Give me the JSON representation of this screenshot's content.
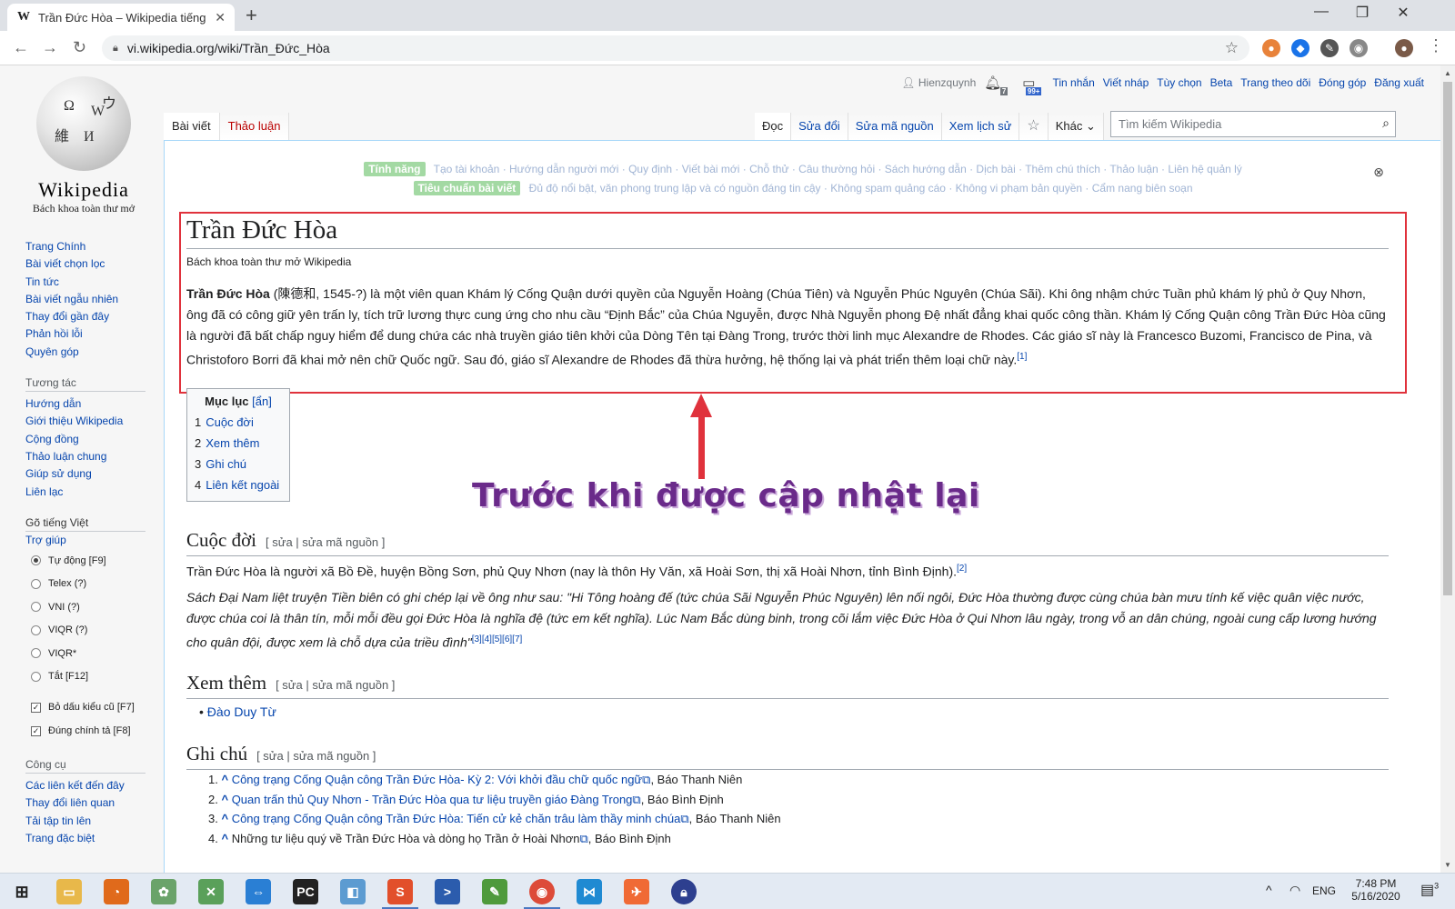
{
  "browser": {
    "tab_title": "Trần Đức Hòa – Wikipedia tiếng V",
    "favicon": "W",
    "url": "vi.wikipedia.org/wiki/Trần_Đức_Hòa"
  },
  "wiki": {
    "wordmark": "Wikipedia",
    "tagline": "Bách khoa toàn thư mở",
    "personal": {
      "user": "Hienzquynh",
      "alerts_count": "7",
      "notices_count": "99+",
      "links": [
        "Tin nhắn",
        "Viết nháp",
        "Tùy chọn",
        "Beta",
        "Trang theo dõi",
        "Đóng góp",
        "Đăng xuất"
      ]
    },
    "left_tabs": [
      "Bài viết",
      "Thảo luận"
    ],
    "right_tabs": [
      "Đọc",
      "Sửa đổi",
      "Sửa mã nguồn",
      "Xem lịch sử"
    ],
    "more_label": "Khác",
    "search_placeholder": "Tìm kiếm Wikipedia",
    "sidebar_main": [
      "Trang Chính",
      "Bài viết chọn lọc",
      "Tin tức",
      "Bài viết ngẫu nhiên",
      "Thay đổi gần đây",
      "Phản hồi lỗi",
      "Quyên góp"
    ],
    "sidebar_interact_heading": "Tương tác",
    "sidebar_interact": [
      "Hướng dẫn",
      "Giới thiệu Wikipedia",
      "Cộng đồng",
      "Thảo luận chung",
      "Giúp sử dụng",
      "Liên lạc"
    ],
    "sidebar_input_heading": "Gõ tiếng Việt",
    "sidebar_input_help": "Trợ giúp",
    "input_modes": [
      {
        "label": "Tự động [F9]",
        "selected": true
      },
      {
        "label": "Telex (?)",
        "selected": false
      },
      {
        "label": "VNI (?)",
        "selected": false
      },
      {
        "label": "VIQR (?)",
        "selected": false
      },
      {
        "label": "VIQR*",
        "selected": false
      },
      {
        "label": "Tắt [F12]",
        "selected": false
      }
    ],
    "input_options": [
      {
        "label": "Bỏ dấu kiểu cũ [F7]",
        "checked": true
      },
      {
        "label": "Đúng chính tả [F8]",
        "checked": true
      }
    ],
    "sidebar_tools_heading": "Công cụ",
    "sidebar_tools": [
      "Các liên kết đến đây",
      "Thay đổi liên quan",
      "Tải tập tin lên",
      "Trang đặc biệt"
    ],
    "notice_line1_label": "Tính năng",
    "notice_line1": "Tạo tài khoản · Hướng dẫn người mới · Quy định · Viết bài mới · Chỗ thử · Câu thường hỏi · Sách hướng dẫn · Dịch bài · Thêm chú thích · Thảo luận · Liên hệ quản lý",
    "notice_line2_label": "Tiêu chuẩn bài viết",
    "notice_line2": "Đủ độ nổi bật, văn phong trung lập và có nguồn đáng tin cậy · Không spam quảng cáo · Không vi phạm bản quyền · Cẩm nang biên soạn"
  },
  "article": {
    "title": "Trần Đức Hòa",
    "from": "Bách khoa toàn thư mở Wikipedia",
    "lead_bold": "Trần Đức Hòa",
    "lead_rest": "(陳德和, 1545-?) là một viên quan Khám lý Cống Quận dưới quyền của Nguyễn Hoàng (Chúa Tiên) và Nguyễn Phúc Nguyên (Chúa Sãi). Khi ông nhậm chức Tuần phủ khám lý phủ ở Quy Nhơn, ông đã có công giữ yên trấn ly, tích trữ lương thực cung ứng cho nhu cầu “Định Bắc” của Chúa Nguyễn, được Nhà Nguyễn phong Đệ nhất đẳng khai quốc công thần. Khám lý Cống Quận công Trần Đức Hòa cũng là người đã bất chấp nguy hiểm để dung chứa các nhà truyền giáo tiên khởi của Dòng Tên tại Đàng Trong, trước thời linh mục Alexandre de Rhodes. Các giáo sĩ này là Francesco Buzomi, Francisco de Pina, và Christoforo Borri đã khai mở nên chữ Quốc ngữ. Sau đó, giáo sĩ Alexandre de Rhodes đã thừa hưởng, hệ thống lại và phát triển thêm loại chữ này.",
    "lead_ref": "[1]",
    "toc_title": "Mục lục",
    "toc_hide": "[ẩn]",
    "toc": [
      {
        "num": "1",
        "label": "Cuộc đời"
      },
      {
        "num": "2",
        "label": "Xem thêm"
      },
      {
        "num": "3",
        "label": "Ghi chú"
      },
      {
        "num": "4",
        "label": "Liên kết ngoài"
      }
    ],
    "callout": "Trước khi được cập nhật lại",
    "sec1_title": "Cuộc đời",
    "sec1_edit": "[ sửa | sửa mã nguồn ]",
    "sec1_p1": "Trần Đức Hòa là người xã Bồ Đề, huyện Bồng Sơn, phủ Quy Nhơn (nay là thôn Hy Văn, xã Hoài Sơn, thị xã Hoài Nhơn, tỉnh Bình Định).",
    "sec1_p1_ref": "[2]",
    "sec1_p2": "Sách Đại Nam liệt truyện Tiền biên có ghi chép lại về ông như sau: \"Hi Tông hoàng đế (tức chúa Sãi Nguyễn Phúc Nguyên) lên nối ngôi, Đức Hòa thường được cùng chúa bàn mưu tính kế việc quân việc nước, được chúa coi là thân tín, mỗi mỗi đều gọi Đức Hòa là nghĩa đệ (tức em kết nghĩa). Lúc Nam Bắc dùng binh, trong cõi lắm việc Đức Hòa ở Qui Nhơn lâu ngày, trong vỗ an dân chúng, ngoài cung cấp lương hướng cho quân đội, được xem là chỗ dựa của triều đình\"",
    "sec1_p2_ref": "[3][4][5][6][7]",
    "sec2_title": "Xem thêm",
    "sec2_edit": "[ sửa | sửa mã nguồn ]",
    "sec2_items": [
      "Đào Duy Từ"
    ],
    "sec3_title": "Ghi chú",
    "sec3_edit": "[ sửa | sửa mã nguồn ]",
    "notes": [
      {
        "link": "Công trạng Cống Quận công Trần Đức Hòa- Kỳ 2: Với khởi đầu chữ quốc ngữ",
        "source": ", Báo Thanh Niên"
      },
      {
        "link": "Quan trấn thủ Quy Nhơn - Trần Đức Hòa qua tư liệu truyền giáo Đàng Trong",
        "source": ", Báo Bình Định"
      },
      {
        "link": "Công trạng Cống Quận công Trần Đức Hòa: Tiến cử kẻ chăn trâu làm thầy minh chúa",
        "source": ", Báo Thanh Niên"
      },
      {
        "link": "Những tư liệu quý về Trần Đức Hòa và dòng họ Trần ở Hoài Nhơn",
        "source": ", Báo Bình Định"
      }
    ]
  },
  "taskbar": {
    "lang": "ENG",
    "time": "7:48 PM",
    "date": "5/16/2020",
    "notification_count": "3"
  },
  "colors": {
    "highlight_box": "#e0323c",
    "callout_text": "#6a2a8a",
    "link": "#0645ad"
  }
}
